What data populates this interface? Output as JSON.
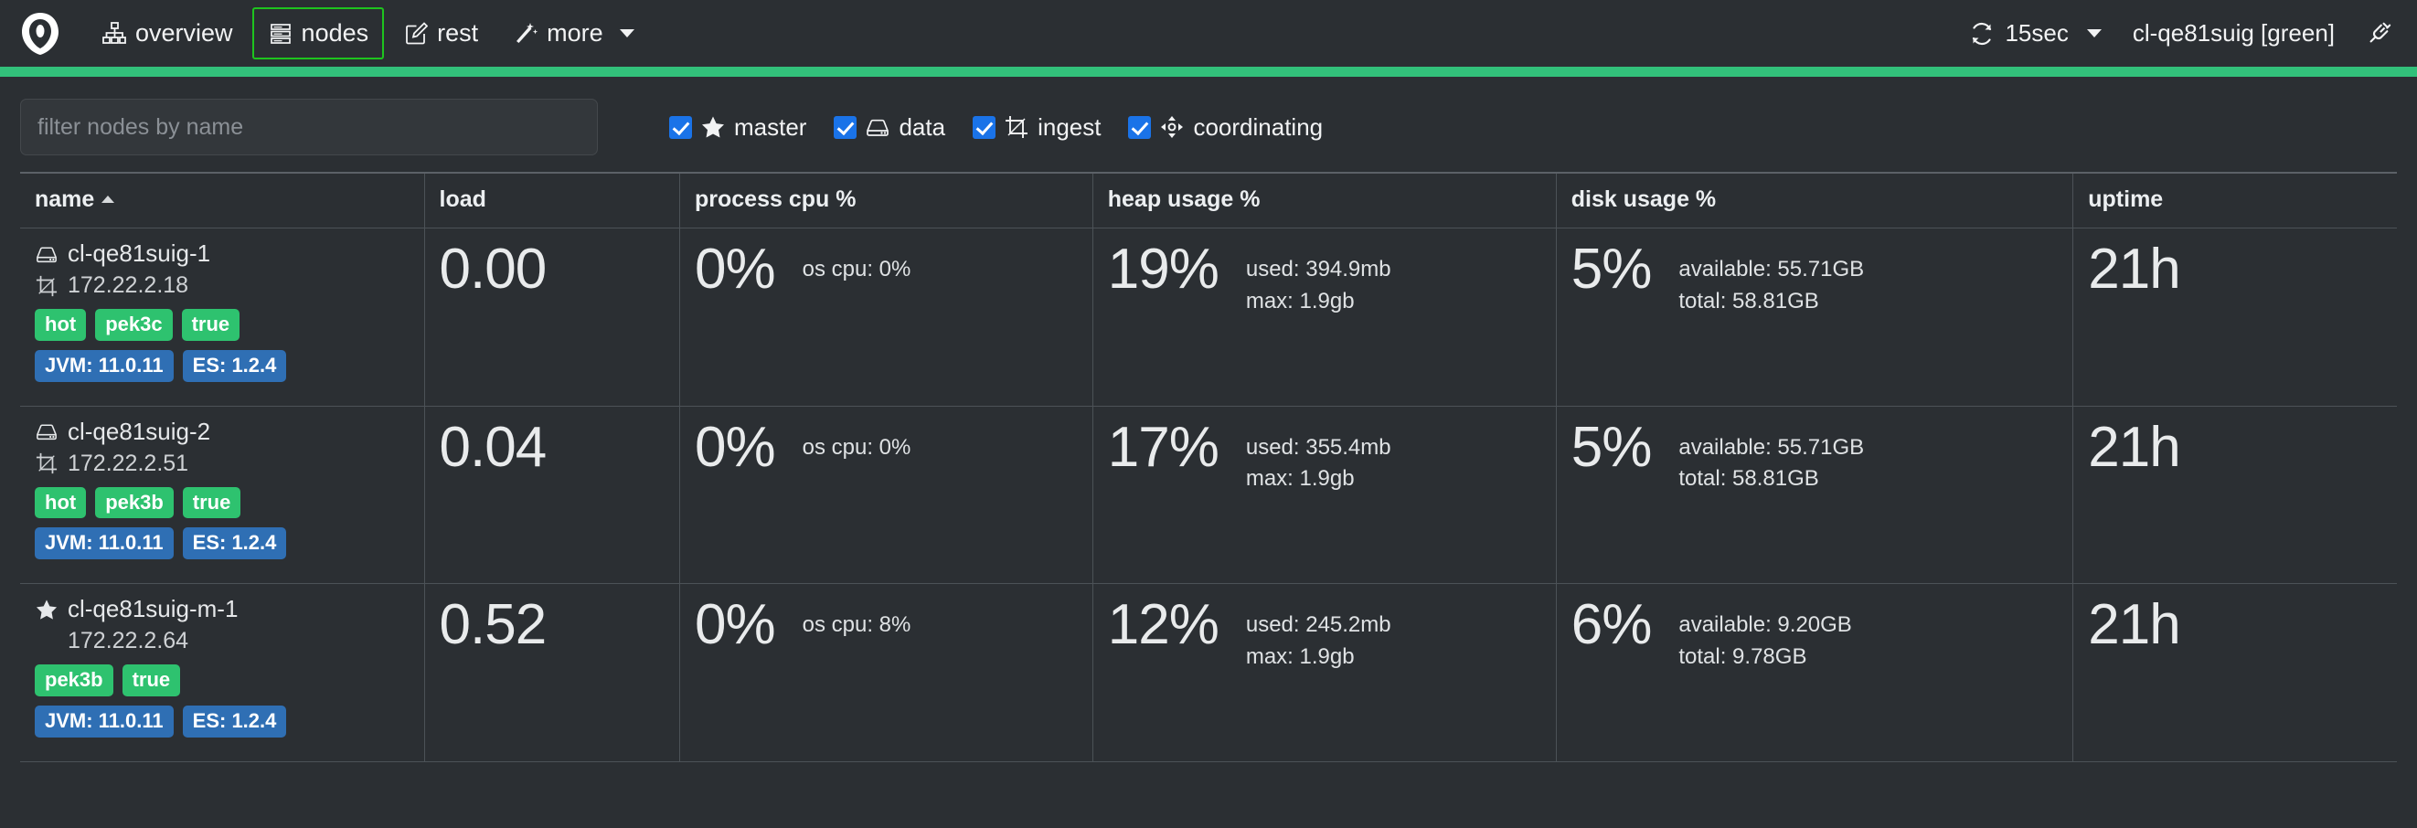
{
  "navbar": {
    "brand_icon": "cerebro-logo-icon",
    "items": [
      {
        "label": "overview",
        "icon": "sitemap-icon",
        "active": false
      },
      {
        "label": "nodes",
        "icon": "server-list-icon",
        "active": true
      },
      {
        "label": "rest",
        "icon": "edit-square-icon",
        "active": false
      },
      {
        "label": "more",
        "icon": "magic-wand-icon",
        "active": false,
        "has_caret": true
      }
    ],
    "refresh_interval": "15sec",
    "refresh_icon": "refresh-icon",
    "cluster_label": "cl-qe81suig [green]",
    "disconnect_icon": "plug-icon",
    "health_color": "#32c07a"
  },
  "filter": {
    "placeholder": "filter nodes by name",
    "value": "",
    "roles": [
      {
        "label": "master",
        "icon": "star-icon",
        "checked": true
      },
      {
        "label": "data",
        "icon": "disk-icon",
        "checked": true
      },
      {
        "label": "ingest",
        "icon": "crop-icon",
        "checked": true
      },
      {
        "label": "coordinating",
        "icon": "diamond-arrows-icon",
        "checked": true
      }
    ]
  },
  "table": {
    "columns": [
      {
        "key": "name",
        "label": "name",
        "sorted": "asc"
      },
      {
        "key": "load",
        "label": "load"
      },
      {
        "key": "cpu",
        "label": "process cpu %"
      },
      {
        "key": "heap",
        "label": "heap usage %"
      },
      {
        "key": "disk",
        "label": "disk usage %"
      },
      {
        "key": "uptime",
        "label": "uptime"
      }
    ],
    "rows": [
      {
        "name": "cl-qe81suig-1",
        "name_icon": "disk-icon",
        "ip": "172.22.2.18",
        "ip_icon": "crop-icon",
        "attr_badges": [
          "hot",
          "pek3c",
          "true"
        ],
        "version_badges": [
          "JVM: 11.0.11",
          "ES: 1.2.4"
        ],
        "load": "0.00",
        "process_cpu": "0%",
        "os_cpu": "os cpu: 0%",
        "heap_pct": "19%",
        "heap_used": "used: 394.9mb",
        "heap_max": "max: 1.9gb",
        "disk_pct": "5%",
        "disk_available": "available: 55.71GB",
        "disk_total": "total: 58.81GB",
        "uptime": "21h"
      },
      {
        "name": "cl-qe81suig-2",
        "name_icon": "disk-icon",
        "ip": "172.22.2.51",
        "ip_icon": "crop-icon",
        "attr_badges": [
          "hot",
          "pek3b",
          "true"
        ],
        "version_badges": [
          "JVM: 11.0.11",
          "ES: 1.2.4"
        ],
        "load": "0.04",
        "process_cpu": "0%",
        "os_cpu": "os cpu: 0%",
        "heap_pct": "17%",
        "heap_used": "used: 355.4mb",
        "heap_max": "max: 1.9gb",
        "disk_pct": "5%",
        "disk_available": "available: 55.71GB",
        "disk_total": "total: 58.81GB",
        "uptime": "21h"
      },
      {
        "name": "cl-qe81suig-m-1",
        "name_icon": "star-icon",
        "ip": "172.22.2.64",
        "ip_icon": "none",
        "attr_badges": [
          "pek3b",
          "true"
        ],
        "version_badges": [
          "JVM: 11.0.11",
          "ES: 1.2.4"
        ],
        "load": "0.52",
        "process_cpu": "0%",
        "os_cpu": "os cpu: 8%",
        "heap_pct": "12%",
        "heap_used": "used: 245.2mb",
        "heap_max": "max: 1.9gb",
        "disk_pct": "6%",
        "disk_available": "available: 9.20GB",
        "disk_total": "total: 9.78GB",
        "uptime": "21h"
      }
    ]
  }
}
